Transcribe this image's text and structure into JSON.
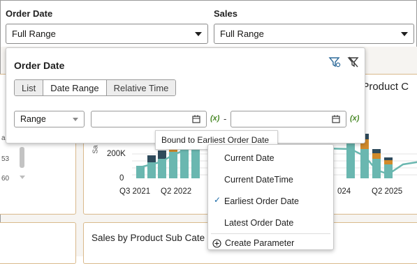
{
  "filters": [
    {
      "label": "Order Date",
      "value": "Full Range"
    },
    {
      "label": "Sales",
      "value": "Full Range"
    }
  ],
  "popup": {
    "title": "Order Date",
    "tabs": [
      "List",
      "Date Range",
      "Relative Time"
    ],
    "selected_tab": "Date Range",
    "range_select": "Range",
    "start_value": "",
    "end_value": "",
    "separator": "-",
    "fx": "(x)",
    "fx_end": "(x)"
  },
  "tooltip": "Bound to Earliest Order Date",
  "menu": {
    "items": [
      "Current Date",
      "Current DateTime",
      "Earliest Order Date",
      "Latest Order Date"
    ],
    "checked": "Earliest Order Date",
    "create": "Create Parameter"
  },
  "background": {
    "card_title_right": ", Product C",
    "card_title_bottom": "Sales by Product Sub Cate",
    "left_values": [
      "al",
      "53",
      "60"
    ]
  },
  "chart_data": {
    "type": "bar",
    "y_axis": {
      "ticks": [
        "200K",
        "0"
      ]
    },
    "x_ticks_left": [
      "Q3 2021",
      "Q2 2022"
    ],
    "x_ticks_right": [
      "024",
      "Q2 2025"
    ],
    "ylabel_fragment": "Sa",
    "colors": {
      "teal": "#6ab7b0",
      "orange": "#d18a2a",
      "navy": "#2f4b5c",
      "line": "#6ab7b0"
    }
  }
}
